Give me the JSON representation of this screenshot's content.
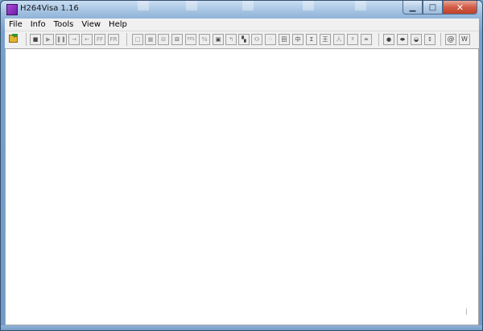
{
  "window": {
    "title": "H264Visa 1.16",
    "icon": "app-icon",
    "controls": {
      "minimize": "▁",
      "maximize": "□",
      "close": "✕"
    }
  },
  "menu": {
    "items": [
      {
        "label": "File"
      },
      {
        "label": "Info"
      },
      {
        "label": "Tools"
      },
      {
        "label": "View"
      },
      {
        "label": "Help"
      }
    ]
  },
  "toolbar": {
    "open_icon": "open-folder-icon",
    "buttons": {
      "stop": "■",
      "play": "▶",
      "pause": "❚❚",
      "step_forward": "→",
      "step_back": "←",
      "fast_forward": "FF",
      "fast_rewind": "FR",
      "single_block": "□",
      "grid_fine": "▦",
      "split_v": "⊟",
      "split_h": "⊟",
      "fps": "FPS",
      "qp": "⁶⁄₄",
      "save": "▣",
      "rotate": "↰",
      "checker": "▚",
      "binoculars": "⚇",
      "dots": "⁘",
      "grid_cross": "田",
      "center_mark": "中",
      "sum": "Σ",
      "tee": "王",
      "person": "人",
      "small_a": "ª",
      "equal_top": "≐",
      "circle": "●",
      "ellipse": "⬬",
      "half_ellipse": "◒",
      "up_down": "↕",
      "at": "@",
      "w": "W"
    }
  },
  "colors": {
    "title_gradient_top": "#c9def2",
    "close_button": "#c1412a",
    "app_icon": "#8a2fc4",
    "menu_bg": "#f0f0f0",
    "client_bg": "#ffffff"
  }
}
